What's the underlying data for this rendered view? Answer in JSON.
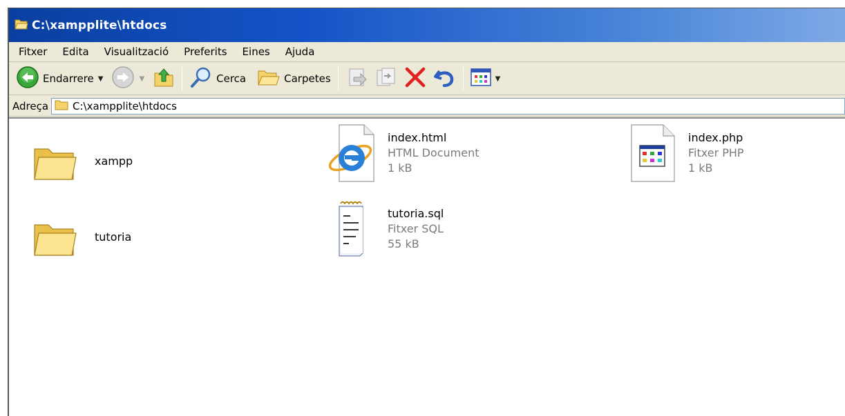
{
  "window": {
    "title": "C:\\xampplite\\htdocs"
  },
  "menu": {
    "items": [
      "Fitxer",
      "Edita",
      "Visualització",
      "Preferits",
      "Eines",
      "Ajuda"
    ]
  },
  "toolbar": {
    "back_label": "Endarrere",
    "search_label": "Cerca",
    "folders_label": "Carpetes"
  },
  "address": {
    "label": "Adreça",
    "value": "C:\\xampplite\\htdocs"
  },
  "files": [
    {
      "name": "xampp",
      "kind": "folder"
    },
    {
      "name": "index.html",
      "type": "HTML Document",
      "size": "1 kB",
      "kind": "html"
    },
    {
      "name": "index.php",
      "type": "Fitxer PHP",
      "size": "1 kB",
      "kind": "php"
    },
    {
      "name": "tutoria",
      "kind": "folder"
    },
    {
      "name": "tutoria.sql",
      "type": "Fitxer SQL",
      "size": "55 kB",
      "kind": "sql"
    }
  ],
  "colors": {
    "titlebar": "#0a3fa0",
    "chrome": "#ece9d8",
    "delete": "#e02020"
  }
}
